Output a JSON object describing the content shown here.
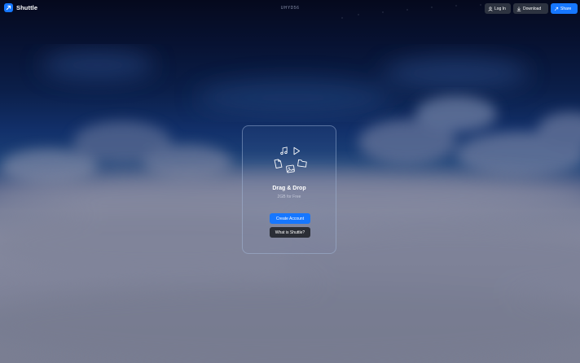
{
  "app": {
    "name": "Shuttle",
    "center_label": "UHYD56"
  },
  "nav": {
    "login_label": "Log In",
    "download_label": "Download",
    "share_label": "Share"
  },
  "upload_card": {
    "title": "Drag & Drop",
    "subtitle": "2GB for Free",
    "create_account_label": "Create Account",
    "what_is_label": "What is Shuttle?",
    "file_icons": [
      "music-note-icon",
      "play-icon",
      "document-icon",
      "folder-icon",
      "image-icon"
    ]
  },
  "colors": {
    "accent": "#1677ff",
    "dark_button": "#2d3340",
    "sky_top": "#05091d",
    "cloud": "#868aa0"
  }
}
